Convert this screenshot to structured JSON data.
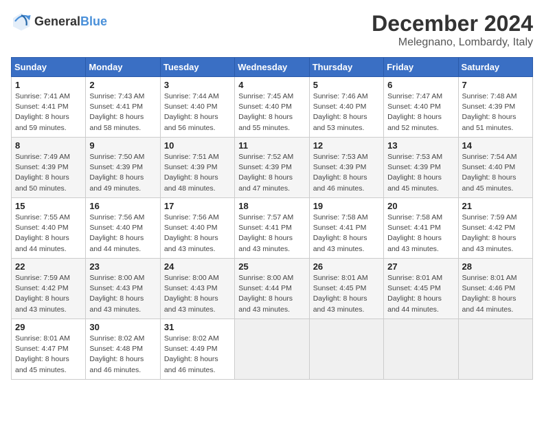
{
  "header": {
    "logo": {
      "general": "General",
      "blue": "Blue"
    },
    "title": "December 2024",
    "location": "Melegnano, Lombardy, Italy"
  },
  "weekdays": [
    "Sunday",
    "Monday",
    "Tuesday",
    "Wednesday",
    "Thursday",
    "Friday",
    "Saturday"
  ],
  "weeks": [
    [
      {
        "day": 1,
        "sunrise": "7:41 AM",
        "sunset": "4:41 PM",
        "daylight": "8 hours and 59 minutes."
      },
      {
        "day": 2,
        "sunrise": "7:43 AM",
        "sunset": "4:41 PM",
        "daylight": "8 hours and 58 minutes."
      },
      {
        "day": 3,
        "sunrise": "7:44 AM",
        "sunset": "4:40 PM",
        "daylight": "8 hours and 56 minutes."
      },
      {
        "day": 4,
        "sunrise": "7:45 AM",
        "sunset": "4:40 PM",
        "daylight": "8 hours and 55 minutes."
      },
      {
        "day": 5,
        "sunrise": "7:46 AM",
        "sunset": "4:40 PM",
        "daylight": "8 hours and 53 minutes."
      },
      {
        "day": 6,
        "sunrise": "7:47 AM",
        "sunset": "4:40 PM",
        "daylight": "8 hours and 52 minutes."
      },
      {
        "day": 7,
        "sunrise": "7:48 AM",
        "sunset": "4:39 PM",
        "daylight": "8 hours and 51 minutes."
      }
    ],
    [
      {
        "day": 8,
        "sunrise": "7:49 AM",
        "sunset": "4:39 PM",
        "daylight": "8 hours and 50 minutes."
      },
      {
        "day": 9,
        "sunrise": "7:50 AM",
        "sunset": "4:39 PM",
        "daylight": "8 hours and 49 minutes."
      },
      {
        "day": 10,
        "sunrise": "7:51 AM",
        "sunset": "4:39 PM",
        "daylight": "8 hours and 48 minutes."
      },
      {
        "day": 11,
        "sunrise": "7:52 AM",
        "sunset": "4:39 PM",
        "daylight": "8 hours and 47 minutes."
      },
      {
        "day": 12,
        "sunrise": "7:53 AM",
        "sunset": "4:39 PM",
        "daylight": "8 hours and 46 minutes."
      },
      {
        "day": 13,
        "sunrise": "7:53 AM",
        "sunset": "4:39 PM",
        "daylight": "8 hours and 45 minutes."
      },
      {
        "day": 14,
        "sunrise": "7:54 AM",
        "sunset": "4:40 PM",
        "daylight": "8 hours and 45 minutes."
      }
    ],
    [
      {
        "day": 15,
        "sunrise": "7:55 AM",
        "sunset": "4:40 PM",
        "daylight": "8 hours and 44 minutes."
      },
      {
        "day": 16,
        "sunrise": "7:56 AM",
        "sunset": "4:40 PM",
        "daylight": "8 hours and 44 minutes."
      },
      {
        "day": 17,
        "sunrise": "7:56 AM",
        "sunset": "4:40 PM",
        "daylight": "8 hours and 43 minutes."
      },
      {
        "day": 18,
        "sunrise": "7:57 AM",
        "sunset": "4:41 PM",
        "daylight": "8 hours and 43 minutes."
      },
      {
        "day": 19,
        "sunrise": "7:58 AM",
        "sunset": "4:41 PM",
        "daylight": "8 hours and 43 minutes."
      },
      {
        "day": 20,
        "sunrise": "7:58 AM",
        "sunset": "4:41 PM",
        "daylight": "8 hours and 43 minutes."
      },
      {
        "day": 21,
        "sunrise": "7:59 AM",
        "sunset": "4:42 PM",
        "daylight": "8 hours and 43 minutes."
      }
    ],
    [
      {
        "day": 22,
        "sunrise": "7:59 AM",
        "sunset": "4:42 PM",
        "daylight": "8 hours and 43 minutes."
      },
      {
        "day": 23,
        "sunrise": "8:00 AM",
        "sunset": "4:43 PM",
        "daylight": "8 hours and 43 minutes."
      },
      {
        "day": 24,
        "sunrise": "8:00 AM",
        "sunset": "4:43 PM",
        "daylight": "8 hours and 43 minutes."
      },
      {
        "day": 25,
        "sunrise": "8:00 AM",
        "sunset": "4:44 PM",
        "daylight": "8 hours and 43 minutes."
      },
      {
        "day": 26,
        "sunrise": "8:01 AM",
        "sunset": "4:45 PM",
        "daylight": "8 hours and 43 minutes."
      },
      {
        "day": 27,
        "sunrise": "8:01 AM",
        "sunset": "4:45 PM",
        "daylight": "8 hours and 44 minutes."
      },
      {
        "day": 28,
        "sunrise": "8:01 AM",
        "sunset": "4:46 PM",
        "daylight": "8 hours and 44 minutes."
      }
    ],
    [
      {
        "day": 29,
        "sunrise": "8:01 AM",
        "sunset": "4:47 PM",
        "daylight": "8 hours and 45 minutes."
      },
      {
        "day": 30,
        "sunrise": "8:02 AM",
        "sunset": "4:48 PM",
        "daylight": "8 hours and 46 minutes."
      },
      {
        "day": 31,
        "sunrise": "8:02 AM",
        "sunset": "4:49 PM",
        "daylight": "8 hours and 46 minutes."
      },
      null,
      null,
      null,
      null
    ]
  ]
}
